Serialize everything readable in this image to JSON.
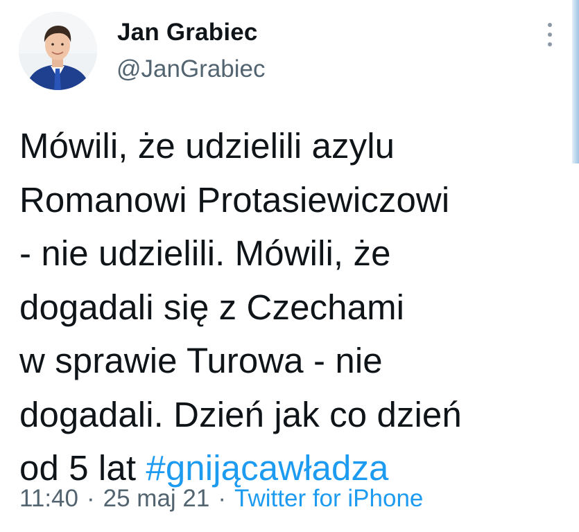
{
  "author": {
    "name": "Jan Grabiec",
    "handle": "@JanGrabiec"
  },
  "tweet": {
    "lines": [
      "Mówili, że udzielili azylu",
      "Romanowi Protasiewiczowi",
      "- nie udzielili. Mówili, że",
      "dogadali się z Czechami",
      "w sprawie Turowa - nie",
      "dogadali. Dzień jak co dzień"
    ],
    "last_line_prefix": "od 5 lat ",
    "hashtag": "#gnijącawładza"
  },
  "meta": {
    "time": "11:40",
    "separator": "·",
    "date": "25 maj 21",
    "source": "Twitter for iPhone"
  },
  "icons": {
    "more": "more-vertical-icon"
  },
  "colors": {
    "text": "#0f1419",
    "secondary": "#536471",
    "link": "#1d9bf0"
  }
}
